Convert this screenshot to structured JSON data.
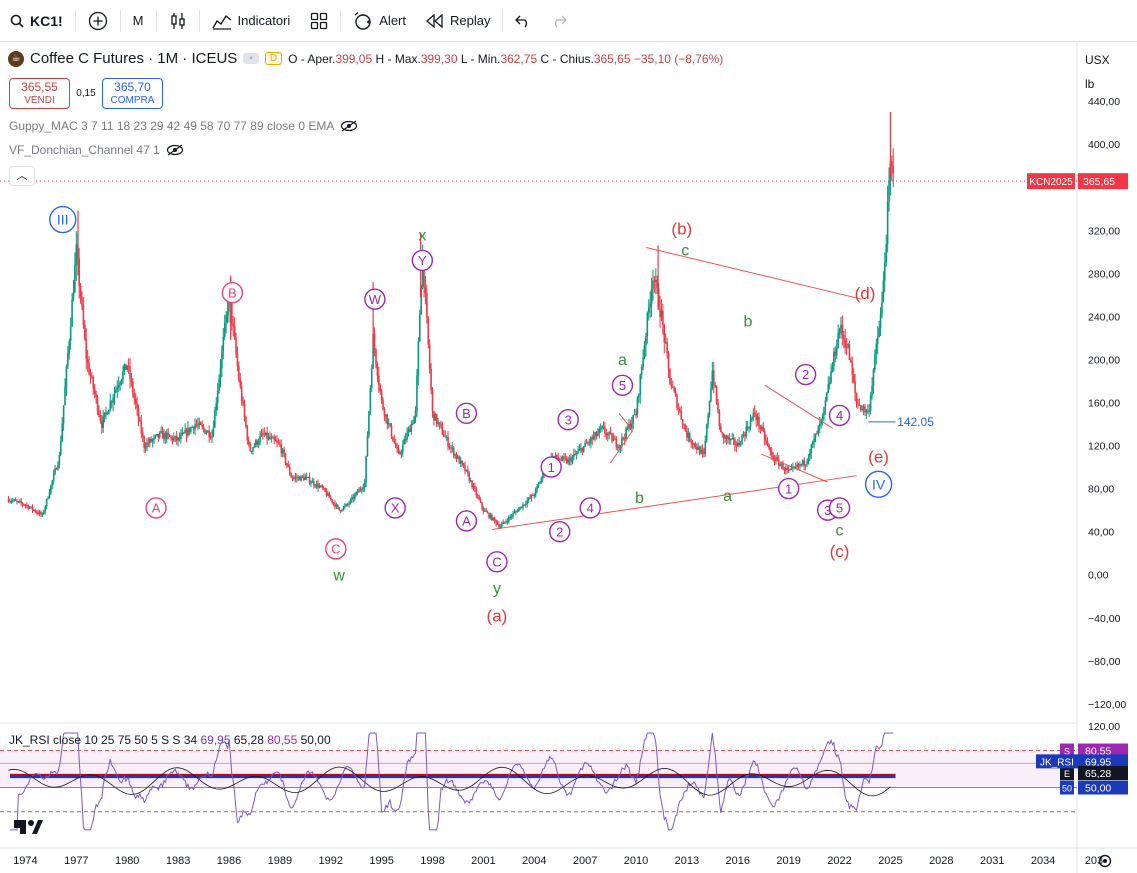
{
  "toolbar": {
    "symbol": "KC1!",
    "interval": "M",
    "indicators_label": "Indicatori",
    "alert_label": "Alert",
    "replay_label": "Replay"
  },
  "legend": {
    "title": "Coffee C Futures · 1M · ICEUS",
    "badge": "D",
    "o_label": "O - Aper.",
    "o": "399,05",
    "h_label": "H - Max.",
    "h": "399,30",
    "l_label": "L - Min.",
    "l": "362,75",
    "c_label": "C - Chius.",
    "c": "365,65",
    "change": "−35,10 (−8,76%)"
  },
  "trade": {
    "sell_price": "365,55",
    "sell_label": "VENDI",
    "spread": "0,15",
    "buy_price": "365,70",
    "buy_label": "COMPRA"
  },
  "indicators": {
    "guppy": "Guppy_MAC 3 7 11 18 23 29 42 49 58 70 77 89 close 0 EMA",
    "donchian": "VF_Donchian_Channel 47 1"
  },
  "rsi_legend": {
    "name": "JK_RSI close 10 25 75 50 5 S S 34",
    "v1": "69,95",
    "v2": "65,28",
    "v3": "80,55",
    "v4": "50,00"
  },
  "units": {
    "currency": "USX",
    "unit": "lb"
  },
  "colors": {
    "up": "#089981",
    "down": "#f23645",
    "purple": "#9c27b0",
    "blue_wave": "#2962ff",
    "green_wave": "#388e3c",
    "red_wave": "#e53935",
    "pink_wave": "#ec407a"
  },
  "chart_data": {
    "type": "candlestick",
    "xlim": [
      1972.5,
      2036
    ],
    "ylim": [
      -135,
      455
    ],
    "x_ticks": [
      1974,
      1977,
      1980,
      1983,
      1986,
      1989,
      1992,
      1995,
      1998,
      2001,
      2004,
      2007,
      2010,
      2013,
      2016,
      2019,
      2022,
      2025,
      2028,
      2031,
      2034,
      2037
    ],
    "x_tick_labels": [
      "1974",
      "1977",
      "1980",
      "1983",
      "1986",
      "1989",
      "1992",
      "1995",
      "1998",
      "2001",
      "2004",
      "2007",
      "2010",
      "2013",
      "2016",
      "2019",
      "2022",
      "2025",
      "2028",
      "2031",
      "2034",
      "203"
    ],
    "y_ticks": [
      440,
      400,
      360,
      320,
      280,
      240,
      200,
      160,
      120,
      80,
      40,
      0,
      -40,
      -80,
      -120
    ],
    "y_tick_labels": [
      "440,00",
      "400,00",
      "",
      "320,00",
      "280,00",
      "240,00",
      "200,00",
      "160,00",
      "120,00",
      "80,00",
      "40,00",
      "0,00",
      "−40,00",
      "−80,00",
      "−120,00"
    ],
    "price_path": [
      [
        1973,
        70
      ],
      [
        1974,
        65
      ],
      [
        1975,
        55
      ],
      [
        1976,
        110
      ],
      [
        1977,
        300
      ],
      [
        1977.6,
        200
      ],
      [
        1978.5,
        140
      ],
      [
        1979.5,
        180
      ],
      [
        1980,
        195
      ],
      [
        1981,
        120
      ],
      [
        1982,
        130
      ],
      [
        1983,
        125
      ],
      [
        1984,
        140
      ],
      [
        1985,
        130
      ],
      [
        1986,
        260
      ],
      [
        1986.6,
        180
      ],
      [
        1987.2,
        115
      ],
      [
        1988,
        130
      ],
      [
        1989,
        120
      ],
      [
        1989.7,
        90
      ],
      [
        1990.5,
        90
      ],
      [
        1991.5,
        80
      ],
      [
        1992.5,
        60
      ],
      [
        1993,
        65
      ],
      [
        1994,
        85
      ],
      [
        1994.5,
        220
      ],
      [
        1995,
        160
      ],
      [
        1996,
        110
      ],
      [
        1997,
        150
      ],
      [
        1997.4,
        300
      ],
      [
        1998,
        150
      ],
      [
        1999,
        120
      ],
      [
        2000,
        95
      ],
      [
        2001,
        60
      ],
      [
        2002,
        45
      ],
      [
        2003,
        60
      ],
      [
        2004,
        75
      ],
      [
        2005,
        110
      ],
      [
        2006,
        105
      ],
      [
        2007,
        120
      ],
      [
        2008,
        135
      ],
      [
        2009,
        120
      ],
      [
        2010,
        150
      ],
      [
        2011,
        280
      ],
      [
        2011.5,
        240
      ],
      [
        2012,
        180
      ],
      [
        2013,
        130
      ],
      [
        2014,
        110
      ],
      [
        2014.5,
        190
      ],
      [
        2015,
        130
      ],
      [
        2016,
        120
      ],
      [
        2017,
        150
      ],
      [
        2018,
        110
      ],
      [
        2019,
        95
      ],
      [
        2020,
        105
      ],
      [
        2021,
        145
      ],
      [
        2022,
        230
      ],
      [
        2022.5,
        210
      ],
      [
        2023,
        160
      ],
      [
        2023.7,
        150
      ],
      [
        2024,
        190
      ],
      [
        2024.5,
        250
      ],
      [
        2025,
        380
      ],
      [
        2025.2,
        365.65
      ]
    ],
    "last_price": 365.65,
    "last_price_label": "KCN2025",
    "last_price_text": "365,65",
    "annotation_price": "142.05",
    "wave_labels": [
      {
        "text": "III",
        "x": 1976.2,
        "y": 330,
        "style": "circle-blue"
      },
      {
        "text": "B",
        "x": 1986.2,
        "y": 262,
        "style": "circle-pink"
      },
      {
        "text": "A",
        "x": 1981.7,
        "y": 62,
        "style": "circle-pink"
      },
      {
        "text": "C",
        "x": 1992.3,
        "y": 24,
        "style": "circle-pink"
      },
      {
        "text": "w",
        "x": 1992.5,
        "y": 0,
        "style": "green"
      },
      {
        "text": "W",
        "x": 1994.6,
        "y": 256,
        "style": "circle-purple"
      },
      {
        "text": "X",
        "x": 1995.8,
        "y": 62,
        "style": "circle-purple"
      },
      {
        "text": "x",
        "x": 1997.4,
        "y": 316,
        "style": "green"
      },
      {
        "text": "Y",
        "x": 1997.4,
        "y": 292,
        "style": "circle-purple"
      },
      {
        "text": "B",
        "x": 2000.0,
        "y": 150,
        "style": "circle-purple"
      },
      {
        "text": "A",
        "x": 2000.0,
        "y": 50,
        "style": "circle-purple"
      },
      {
        "text": "C",
        "x": 2001.8,
        "y": 12,
        "style": "circle-purple"
      },
      {
        "text": "y",
        "x": 2001.8,
        "y": -12,
        "style": "green"
      },
      {
        "text": "(a)",
        "x": 2001.8,
        "y": -38,
        "style": "red"
      },
      {
        "text": "2",
        "x": 2005.5,
        "y": 40,
        "style": "circle-purple"
      },
      {
        "text": "1",
        "x": 2005.0,
        "y": 100,
        "style": "circle-purple"
      },
      {
        "text": "3",
        "x": 2006.0,
        "y": 144,
        "style": "circle-purple"
      },
      {
        "text": "4",
        "x": 2007.3,
        "y": 62,
        "style": "circle-purple"
      },
      {
        "text": "5",
        "x": 2009.2,
        "y": 176,
        "style": "circle-purple"
      },
      {
        "text": "a",
        "x": 2009.2,
        "y": 200,
        "style": "green"
      },
      {
        "text": "b",
        "x": 2010.2,
        "y": 72,
        "style": "green"
      },
      {
        "text": "(b)",
        "x": 2012.7,
        "y": 322,
        "style": "red"
      },
      {
        "text": "c",
        "x": 2012.9,
        "y": 302,
        "style": "green"
      },
      {
        "text": "b",
        "x": 2016.6,
        "y": 236,
        "style": "green"
      },
      {
        "text": "a",
        "x": 2015.4,
        "y": 74,
        "style": "green"
      },
      {
        "text": "1",
        "x": 2019.0,
        "y": 80,
        "style": "circle-purple"
      },
      {
        "text": "2",
        "x": 2020.0,
        "y": 186,
        "style": "circle-purple"
      },
      {
        "text": "4",
        "x": 2022.0,
        "y": 148,
        "style": "circle-purple"
      },
      {
        "text": "3",
        "x": 2021.3,
        "y": 60,
        "style": "circle-purple"
      },
      {
        "text": "5",
        "x": 2022.0,
        "y": 62,
        "style": "circle-purple"
      },
      {
        "text": "c",
        "x": 2022.0,
        "y": 42,
        "style": "green"
      },
      {
        "text": "(c)",
        "x": 2022.0,
        "y": 22,
        "style": "red"
      },
      {
        "text": "(d)",
        "x": 2023.5,
        "y": 262,
        "style": "red"
      },
      {
        "text": "(e)",
        "x": 2024.3,
        "y": 110,
        "style": "red"
      },
      {
        "text": "IV",
        "x": 2024.3,
        "y": 84,
        "style": "circle-blue"
      }
    ],
    "trendlines": [
      {
        "from": [
          2010.6,
          304
        ],
        "to": [
          2023.3,
          256
        ]
      },
      {
        "from": [
          2001.5,
          42
        ],
        "to": [
          2023.0,
          92
        ]
      },
      {
        "from": [
          2017.6,
          176
        ],
        "to": [
          2021.6,
          136
        ]
      },
      {
        "from": [
          2017.4,
          112
        ],
        "to": [
          2021.3,
          86
        ]
      },
      {
        "from": [
          2008.5,
          104
        ],
        "to": [
          2009.8,
          134
        ]
      },
      {
        "from": [
          2009.0,
          150
        ],
        "to": [
          2009.8,
          134
        ]
      }
    ],
    "rsi": {
      "levels": [
        80.55,
        69.95,
        65.28,
        50.0
      ],
      "level_labels": [
        "80,55",
        "69,95",
        "65,28",
        "50,00"
      ],
      "level_prefix": [
        "S",
        "JK_RSI",
        "E",
        "50"
      ]
    }
  }
}
